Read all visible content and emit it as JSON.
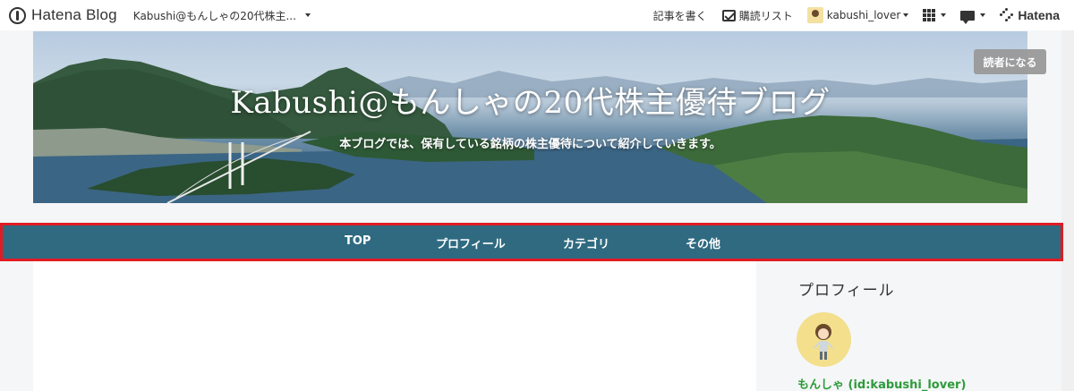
{
  "globalbar": {
    "logo_text": "Hatena Blog",
    "blog_selector": "Kabushi@もんしゃの20代株主...",
    "write_label": "記事を書く",
    "subscriptions_label": "購読リスト",
    "user_name": "kabushi_lover",
    "brand_label": "Hatena"
  },
  "header": {
    "title": "Kabushi@もんしゃの20代株主優待ブログ",
    "description": "本ブログでは、保有している銘柄の株主優待について紹介していきます。",
    "subscribe_label": "読者になる"
  },
  "nav": {
    "items": [
      {
        "label": "TOP"
      },
      {
        "label": "プロフィール"
      },
      {
        "label": "カテゴリ"
      },
      {
        "label": "その他"
      }
    ]
  },
  "sidebar": {
    "module_title": "プロフィール",
    "profile_name": "もんしゃ (id:kabushi_lover)"
  },
  "colors": {
    "nav_background": "#2f6a80",
    "highlight_outline": "#e01b24",
    "profile_link": "#2c9b3a"
  }
}
